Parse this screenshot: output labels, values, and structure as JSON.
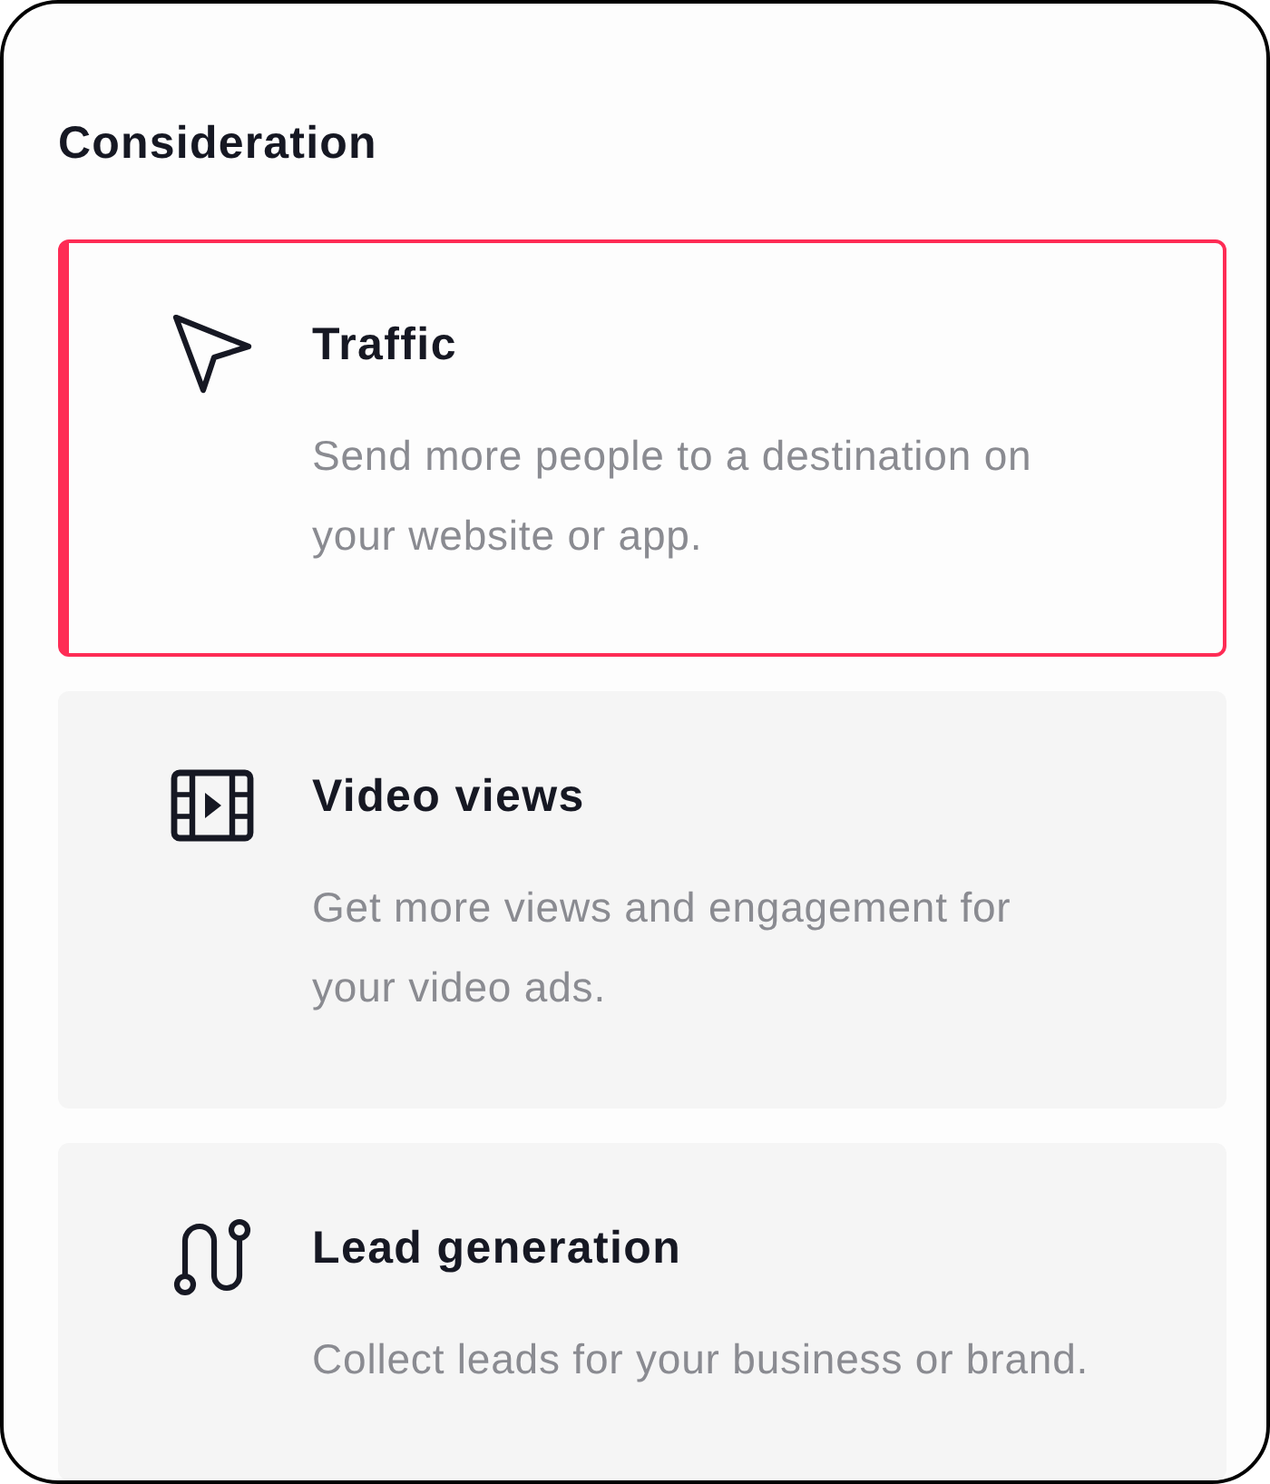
{
  "section": {
    "title": "Consideration"
  },
  "objectives": [
    {
      "kind": "traffic",
      "title": "Traffic",
      "description": "Send more people to a destination on your website or app.",
      "selected": true
    },
    {
      "kind": "video",
      "title": "Video views",
      "description": "Get more views and engagement for your video ads.",
      "selected": false
    },
    {
      "kind": "leads",
      "title": "Lead generation",
      "description": "Collect leads for your business or brand.",
      "selected": false
    }
  ]
}
